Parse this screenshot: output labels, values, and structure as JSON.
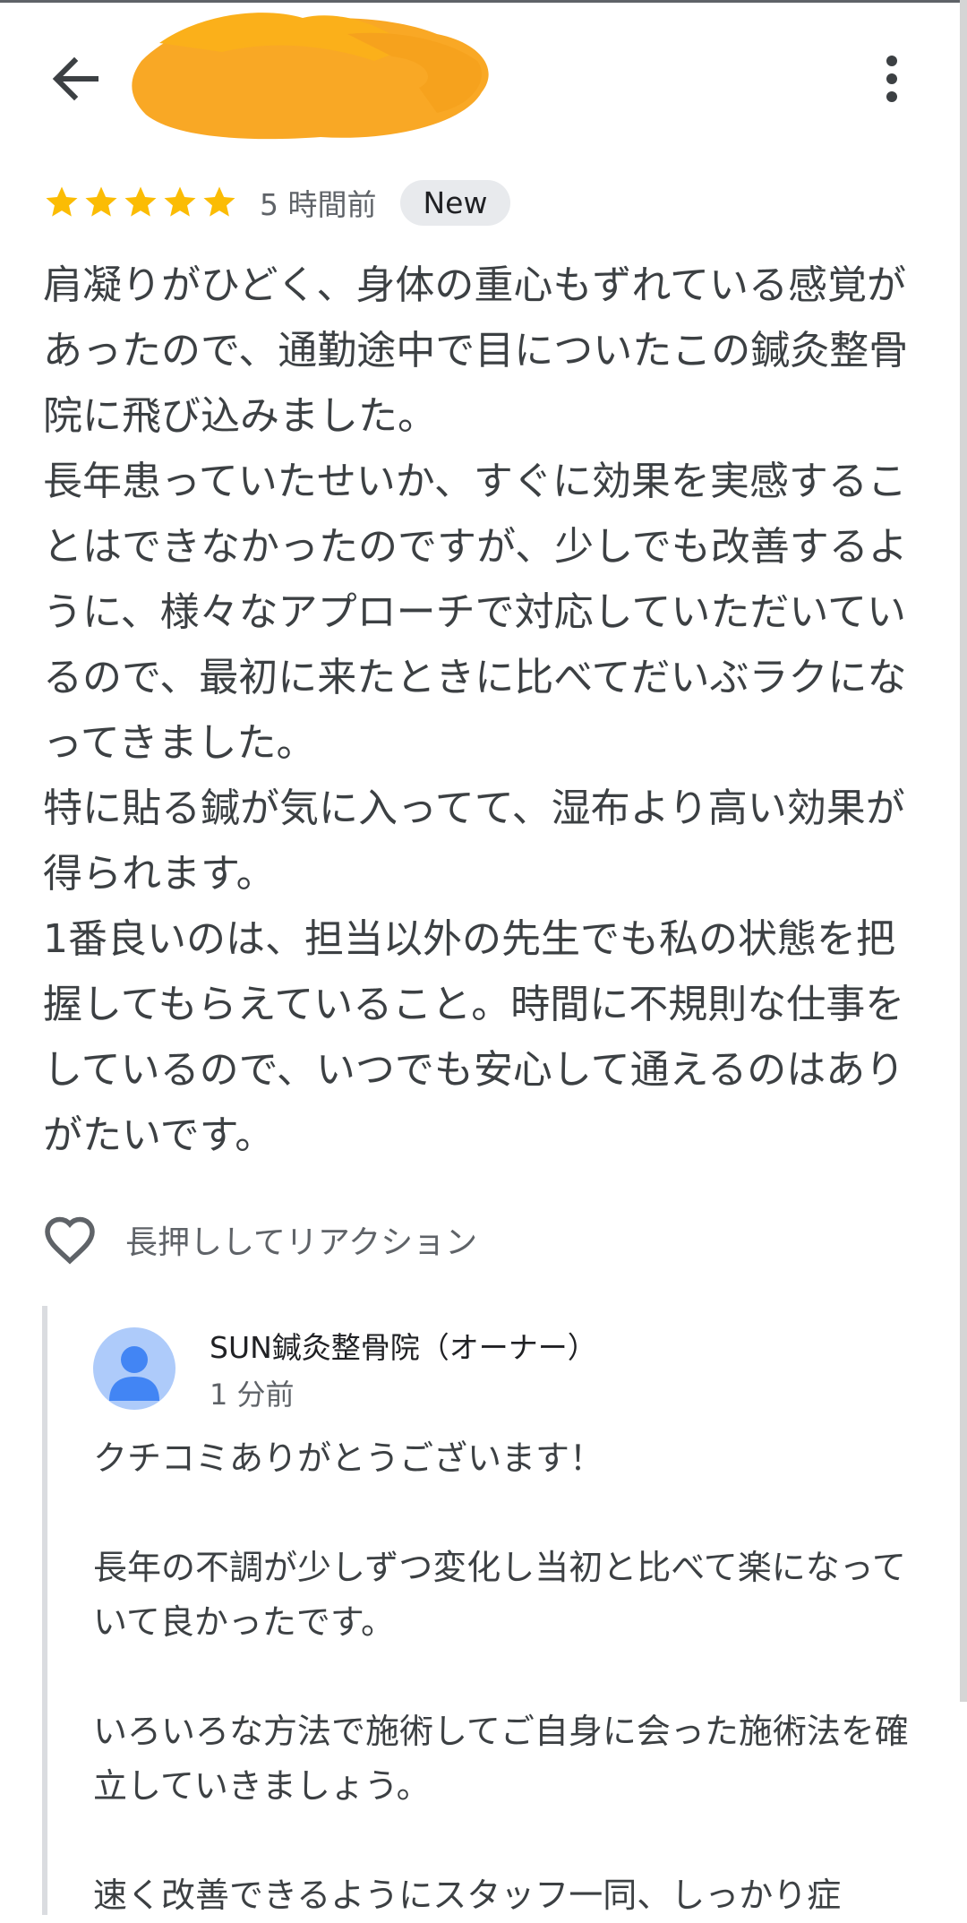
{
  "header": {
    "back_icon": "arrow-back-icon",
    "more_icon": "more-vert-icon"
  },
  "review": {
    "stars": 5,
    "star_color": "#fbbc04",
    "time": "5 時間前",
    "badge": "New",
    "text": "肩凝りがひどく、身体の重心もずれている感覚があったので、通勤途中で目についたこの鍼灸整骨院に飛び込みました。\n長年患っていたせいか、すぐに効果を実感することはできなかったのですが、少しでも改善するように、様々なアプローチで対応していただいているので、最初に来たときに比べてだいぶラクになってきました。\n特に貼る鍼が気に入ってて、湿布より高い効果が得られます。\n1番良いのは、担当以外の先生でも私の状態を把握してもらえていること。時間に不規則な仕事をしているので、いつでも安心して通えるのはありがたいです。"
  },
  "reaction": {
    "icon": "heart-outline-icon",
    "label": "長押ししてリアクション"
  },
  "owner_reply": {
    "name": "SUN鍼灸整骨院（オーナー）",
    "time": "1 分前",
    "avatar_color": "#4285f4",
    "text": "クチコミありがとうございます！\n\n長年の不調が少しずつ変化し当初と比べて楽になっていて良かったです。\n\nいろいろな方法で施術してご自身に会った施術法を確立していきましょう。\n\n速く改善できるようにスタッフ一同、しっかり症"
  }
}
